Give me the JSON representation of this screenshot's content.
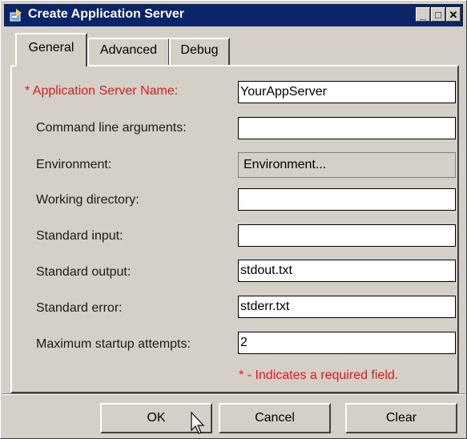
{
  "window": {
    "title": "Create Application Server"
  },
  "title_buttons": {
    "minimize": "_",
    "maximize": "□",
    "close": "✕"
  },
  "tabs": [
    "General",
    "Advanced",
    "Debug"
  ],
  "form": {
    "app_server_name": {
      "label": "* Application Server Name:",
      "value": "YourAppServer"
    },
    "command_line": {
      "label": "Command line arguments:",
      "value": ""
    },
    "environment": {
      "label": "Environment:",
      "button": "Environment..."
    },
    "working_dir": {
      "label": "Working directory:",
      "value": ""
    },
    "std_input": {
      "label": "Standard input:",
      "value": ""
    },
    "std_output": {
      "label": "Standard output:",
      "value": "stdout.txt"
    },
    "std_error": {
      "label": "Standard error:",
      "value": "stderr.txt"
    },
    "max_startup": {
      "label": "Maximum startup attempts:",
      "value": "2"
    }
  },
  "required_note": "* - Indicates a required field.",
  "buttons": {
    "ok": "OK",
    "cancel": "Cancel",
    "clear": "Clear"
  },
  "colors": {
    "titlebar": "#0a246a",
    "required": "#e81818",
    "face": "#d4d0c8"
  },
  "icons": {
    "app": "application-server-icon",
    "cursor": "mouse-pointer-icon"
  }
}
